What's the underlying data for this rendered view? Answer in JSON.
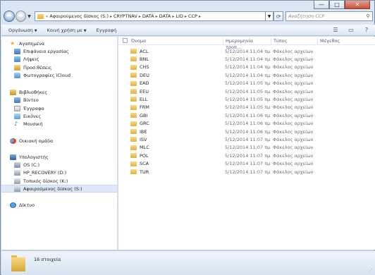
{
  "window": {
    "caption": {
      "minimize": "—",
      "maximize": "□",
      "close": "✕"
    }
  },
  "address": {
    "crumbs": [
      "Αφαιρούμενος δίσκος (S:)",
      "CRYPTNAV",
      "DATA",
      "DATA",
      "LID",
      "CCP"
    ],
    "back_glyph": "←",
    "forward_glyph": "→",
    "overflow": "«"
  },
  "search": {
    "placeholder": "Αναζήτηση CCP"
  },
  "toolbar": {
    "organize": "Οργάνωση",
    "share": "Κοινή χρήση με",
    "burn": "Εγγραφή"
  },
  "nav": {
    "favorites": {
      "header": "Αγαπημένα",
      "items": [
        "Επιφάνεια εργασίας",
        "Λήψεις",
        "Προσ.θέσεις",
        "Φωτογραφίες iCloud"
      ]
    },
    "libraries": {
      "header": "Βιβλιοθήκες",
      "items": [
        "Βίντεο",
        "Έγγραφα",
        "Εικόνες",
        "Μουσική"
      ]
    },
    "homegroup": "Οικιακή ομάδα",
    "computer": {
      "header": "Υπολογιστής",
      "items": [
        "OS (C:)",
        "HP_RECOVERY (D:)",
        "Τοπικός δίσκος (K:)",
        "Αφαιρούμενος δίσκος (S:)"
      ]
    },
    "network": "Δίκτυο"
  },
  "columns": {
    "name": "Όνομα",
    "date": "Ημερομηνία τροπ...",
    "type": "Τύπος",
    "size": "Μέγεθος"
  },
  "files": [
    {
      "name": "ACL",
      "date": "5/12/2014 11:04 πμ",
      "type": "Φάκελος αρχείων"
    },
    {
      "name": "BNL",
      "date": "5/12/2014 11:04 πμ",
      "type": "Φάκελος αρχείων"
    },
    {
      "name": "CHS",
      "date": "5/12/2014 11:04 πμ",
      "type": "Φάκελος αρχείων"
    },
    {
      "name": "DEU",
      "date": "5/12/2014 11:04 πμ",
      "type": "Φάκελος αρχείων"
    },
    {
      "name": "EAD",
      "date": "5/12/2014 11:05 πμ",
      "type": "Φάκελος αρχείων"
    },
    {
      "name": "EEU",
      "date": "5/12/2014 11:05 πμ",
      "type": "Φάκελος αρχείων"
    },
    {
      "name": "ELL",
      "date": "5/12/2014 11:05 πμ",
      "type": "Φάκελος αρχείων"
    },
    {
      "name": "FRM",
      "date": "5/12/2014 11:05 πμ",
      "type": "Φάκελος αρχείων"
    },
    {
      "name": "GBI",
      "date": "5/12/2014 11:06 πμ",
      "type": "Φάκελος αρχείων"
    },
    {
      "name": "GRC",
      "date": "5/12/2014 11:06 πμ",
      "type": "Φάκελος αρχείων"
    },
    {
      "name": "IBE",
      "date": "5/12/2014 11:06 πμ",
      "type": "Φάκελος αρχείων"
    },
    {
      "name": "ISV",
      "date": "5/12/2014 11:07 πμ",
      "type": "Φάκελος αρχείων"
    },
    {
      "name": "MLC",
      "date": "5/12/2014 11:07 πμ",
      "type": "Φάκελος αρχείων"
    },
    {
      "name": "POL",
      "date": "5/12/2014 11:07 πμ",
      "type": "Φάκελος αρχείων"
    },
    {
      "name": "SCA",
      "date": "5/12/2014 11:07 πμ",
      "type": "Φάκελος αρχείων"
    },
    {
      "name": "TUR",
      "date": "5/12/2014 11:07 πμ",
      "type": "Φάκελος αρχείων"
    }
  ],
  "details": {
    "count": "16 στοιχεία"
  }
}
